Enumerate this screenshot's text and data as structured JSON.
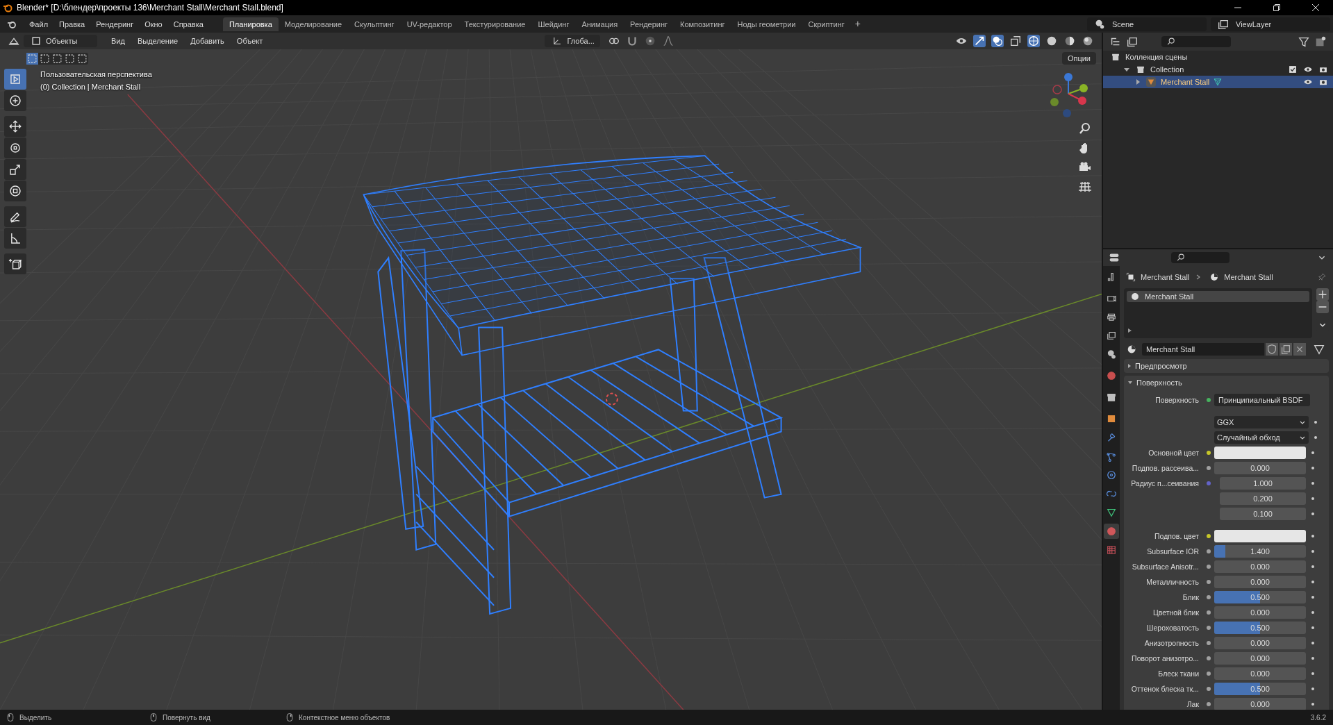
{
  "window": {
    "title": "Blender* [D:\\блендер\\проекты 136\\Merchant Stall\\Merchant Stall.blend]"
  },
  "menu": [
    "Файл",
    "Правка",
    "Рендеринг",
    "Окно",
    "Справка"
  ],
  "workspaces": [
    {
      "label": "Планировка",
      "selected": true
    },
    {
      "label": "Моделирование",
      "selected": false
    },
    {
      "label": "Скульптинг",
      "selected": false
    },
    {
      "label": "UV-редактор",
      "selected": false
    },
    {
      "label": "Текстурирование",
      "selected": false
    },
    {
      "label": "Шейдинг",
      "selected": false
    },
    {
      "label": "Анимация",
      "selected": false
    },
    {
      "label": "Рендеринг",
      "selected": false
    },
    {
      "label": "Композитинг",
      "selected": false
    },
    {
      "label": "Ноды геометрии",
      "selected": false
    },
    {
      "label": "Скриптинг",
      "selected": false
    }
  ],
  "add_tab": "+",
  "scene": "Scene",
  "view_layer": "ViewLayer",
  "viewport": {
    "mode": "Объекты",
    "menus": [
      "Вид",
      "Выделение",
      "Добавить",
      "Объект"
    ],
    "orientation": "Глоба...",
    "options": "Опции",
    "overlay_text": [
      "Пользовательская перспектива",
      "(0) Collection | Merchant Stall"
    ]
  },
  "toolbar": [
    {
      "kind": "select",
      "selected": true
    },
    {
      "kind": "cursor",
      "selected": false
    },
    {
      "kind": "move",
      "selected": false
    },
    {
      "kind": "rotate",
      "selected": false
    },
    {
      "kind": "scale",
      "selected": false
    },
    {
      "kind": "transform",
      "selected": false
    },
    {
      "kind": "annotate",
      "selected": false
    },
    {
      "kind": "measure",
      "selected": false
    },
    {
      "kind": "add_cube",
      "selected": false
    }
  ],
  "outliner": {
    "items": [
      {
        "label": "Коллекция сцены",
        "children": [
          {
            "label": "Collection",
            "expanded": true,
            "selected": false,
            "children": [
              {
                "label": "Merchant Stall",
                "expanded": false,
                "selected": true
              }
            ]
          }
        ]
      }
    ]
  },
  "properties": {
    "tabs": [
      {
        "kind": "tool",
        "selected": false
      },
      {
        "kind": "render",
        "selected": false
      },
      {
        "kind": "output",
        "selected": false
      },
      {
        "kind": "view_layer",
        "selected": false
      },
      {
        "kind": "scene",
        "selected": false
      },
      {
        "kind": "world",
        "selected": false
      },
      {
        "kind": "collection",
        "selected": false
      },
      {
        "kind": "object",
        "selected": false
      },
      {
        "kind": "modifier",
        "selected": false
      },
      {
        "kind": "particles",
        "selected": false
      },
      {
        "kind": "physics",
        "selected": false
      },
      {
        "kind": "constraints",
        "selected": false
      },
      {
        "kind": "data",
        "selected": false
      },
      {
        "kind": "material",
        "selected": true
      },
      {
        "kind": "texture",
        "selected": false
      }
    ],
    "breadcrumb": [
      "Merchant Stall",
      "Merchant Stall"
    ],
    "slots": [
      "Merchant Stall"
    ],
    "material": "Merchant Stall",
    "panels": [
      {
        "label": "Предпросмотр",
        "expanded": false
      },
      {
        "label": "Поверхность",
        "expanded": true
      }
    ],
    "rows": [
      {
        "kind": "shader",
        "label": "Поверхность",
        "value": "Принципиальный BSDF",
        "color": "#46b35e"
      },
      {
        "kind": "dropdown",
        "value": "GGX"
      },
      {
        "kind": "dropdown",
        "value": "Случайный обход"
      },
      {
        "kind": "color",
        "label": "Основной цвет",
        "color": "#c7c729"
      },
      {
        "kind": "number",
        "label": "Подпов. рассеива...",
        "value": "0.000",
        "color": "#a1a1a1"
      },
      {
        "kind": "vector",
        "label": "Радиус п...сеивания",
        "value": "1.000",
        "color": "#6363c7"
      },
      {
        "kind": "vector",
        "value": "0.200"
      },
      {
        "kind": "vector",
        "value": "0.100"
      },
      {
        "kind": "color",
        "label": "Подпов. цвет",
        "color": "#c7c729"
      },
      {
        "kind": "number",
        "label": "Subsurface IOR",
        "value": "1.400",
        "level": 0.12,
        "color": "#a1a1a1"
      },
      {
        "kind": "number",
        "label": "Subsurface Anisotr...",
        "value": "0.000",
        "color": "#a1a1a1"
      },
      {
        "kind": "number",
        "label": "Металличность",
        "value": "0.000",
        "color": "#a1a1a1"
      },
      {
        "kind": "number",
        "label": "Блик",
        "value": "0.500",
        "level": 0.5,
        "color": "#a1a1a1"
      },
      {
        "kind": "number",
        "label": "Цветной блик",
        "value": "0.000",
        "color": "#a1a1a1"
      },
      {
        "kind": "number",
        "label": "Шероховатость",
        "value": "0.500",
        "level": 0.5,
        "color": "#a1a1a1"
      },
      {
        "kind": "number",
        "label": "Анизотропность",
        "value": "0.000",
        "color": "#a1a1a1"
      },
      {
        "kind": "number",
        "label": "Поворот анизотро...",
        "value": "0.000",
        "color": "#a1a1a1"
      },
      {
        "kind": "number",
        "label": "Блеск ткани",
        "value": "0.000",
        "color": "#a1a1a1"
      },
      {
        "kind": "number",
        "label": "Оттенок блеска тк...",
        "value": "0.500",
        "level": 0.5,
        "color": "#a1a1a1"
      },
      {
        "kind": "number",
        "label": "Лак",
        "value": "0.000",
        "color": "#a1a1a1"
      }
    ]
  },
  "status_bar": {
    "hints": [
      "Выделить",
      "Повернуть вид",
      "Контекстное меню объектов"
    ],
    "version": "3.6.2"
  }
}
